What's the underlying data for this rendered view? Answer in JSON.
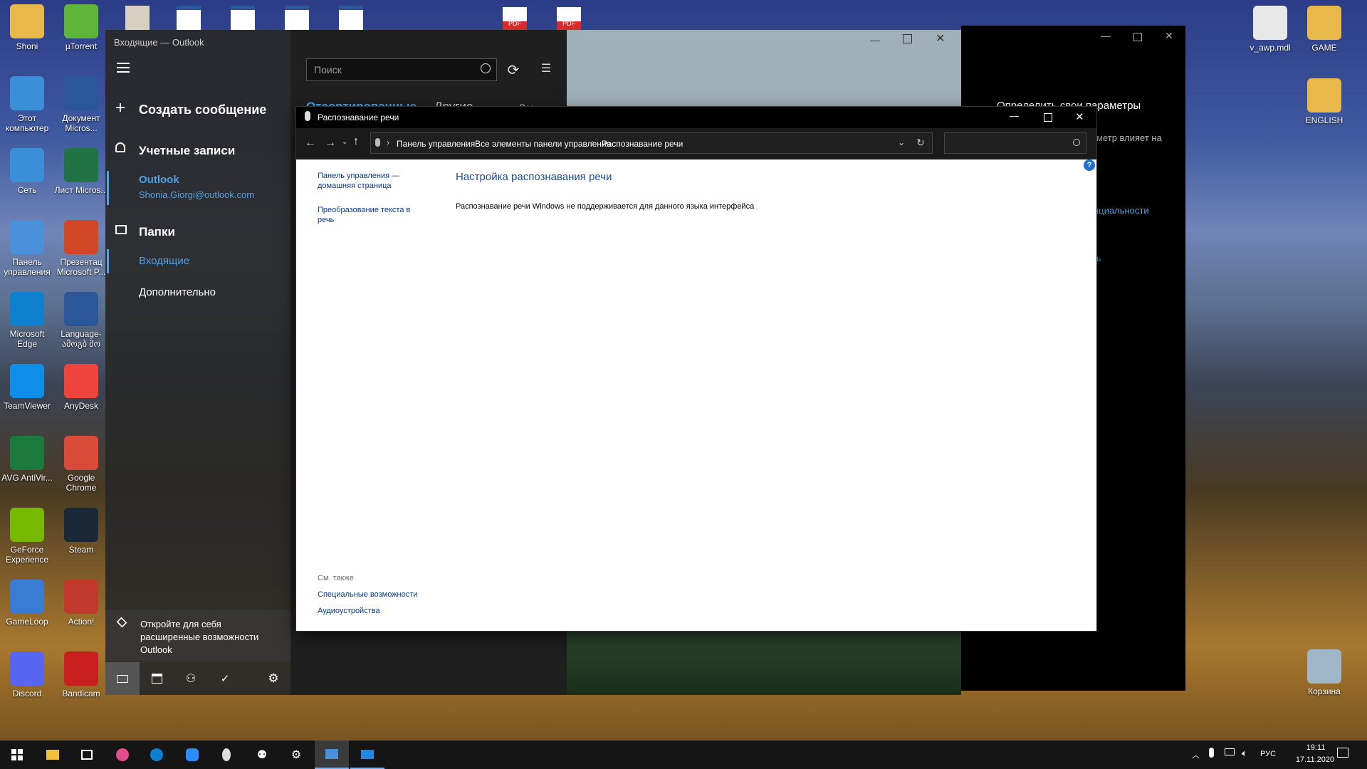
{
  "desktop": {
    "left_icons": [
      {
        "label": "Shoni",
        "icon": "user-folder-icon",
        "color": "#e8b84a"
      },
      {
        "label": "µTorrent",
        "icon": "utorrent-icon",
        "color": "#5fb53a"
      },
      {
        "label": "Этот компьютер",
        "icon": "computer-icon",
        "color": "#3a8fd8"
      },
      {
        "label": "Документ Micros...",
        "icon": "word-doc-icon",
        "color": "#2b579a"
      },
      {
        "label": "Сеть",
        "icon": "network-icon",
        "color": "#3a8fd8"
      },
      {
        "label": "Лист Micros...",
        "icon": "excel-sheet-icon",
        "color": "#217346"
      },
      {
        "label": "Панель управления",
        "icon": "control-panel-icon",
        "color": "#4a90d8"
      },
      {
        "label": "Презентац Microsoft P...",
        "icon": "powerpoint-icon",
        "color": "#d24726"
      },
      {
        "label": "Microsoft Edge",
        "icon": "edge-icon",
        "color": "#0f7fd0"
      },
      {
        "label": "Language- ამოგბ მო",
        "icon": "word-doc-icon",
        "color": "#2b579a"
      },
      {
        "label": "TeamViewer",
        "icon": "teamviewer-icon",
        "color": "#0e8ee9"
      },
      {
        "label": "AnyDesk",
        "icon": "anydesk-icon",
        "color": "#ef443b"
      },
      {
        "label": "AVG AntiVir...",
        "icon": "avg-icon",
        "color": "#1b7a3e"
      },
      {
        "label": "Google Chrome",
        "icon": "chrome-icon",
        "color": "#d94a38"
      },
      {
        "label": "GeForce Experience",
        "icon": "geforce-icon",
        "color": "#76b900"
      },
      {
        "label": "Steam",
        "icon": "steam-icon",
        "color": "#1b2838"
      },
      {
        "label": "GameLoop",
        "icon": "gameloop-icon",
        "color": "#3a7bd5"
      },
      {
        "label": "Action!",
        "icon": "action-icon",
        "color": "#c0392b"
      },
      {
        "label": "Discord",
        "icon": "discord-icon",
        "color": "#5865f2"
      },
      {
        "label": "Bandicam",
        "icon": "bandicam-icon",
        "color": "#c81e1e"
      }
    ],
    "right_icons": [
      {
        "label": "v_awp.mdl",
        "icon": "file-icon",
        "color": "#e8e8e8"
      },
      {
        "label": "GAME",
        "icon": "folder-icon",
        "color": "#e8b84a"
      },
      {
        "label": "ENGLISH",
        "icon": "folder-icon",
        "color": "#e8b84a"
      },
      {
        "label": "Корзина",
        "icon": "recycle-bin-icon",
        "color": "#9fb7c8"
      }
    ],
    "top_partial_icons": [
      {
        "label": "PDF",
        "icon": "pdf-icon"
      },
      {
        "label": "PDF",
        "icon": "pdf-icon"
      }
    ]
  },
  "outlook": {
    "window_title": "Входящие — Outlook",
    "new_message": "Создать сообщение",
    "accounts_label": "Учетные записи",
    "account_name": "Outlook",
    "account_email": "Shonia.Giorgi@outlook.com",
    "folders_label": "Папки",
    "folder_inbox": "Входящие",
    "folder_more": "Дополнительно",
    "promo_text": "Откройте для себя расширенные возможности Outlook",
    "search_placeholder": "Поиск",
    "tab_focused": "Отсортированные",
    "tab_other": "Другие",
    "filter_label": "Все"
  },
  "dark_window": {
    "heading": "Определить свои параметры",
    "text1": "метр влияет на",
    "link1": "нциальности",
    "link2": "ь"
  },
  "control_panel": {
    "title": "Распознавание речи",
    "breadcrumb": [
      "Панель управления",
      "Все элементы панели управления",
      "Распознавание речи"
    ],
    "sidebar_home": "Панель управления — домашняя страница",
    "sidebar_tts": "Преобразование текста в речь",
    "heading": "Настройка распознавания речи",
    "message": "Распознавание речи Windows не поддерживается для данного языка интерфейса",
    "see_also": "См. также",
    "see_also_links": [
      "Специальные возможности",
      "Аудиоустройства"
    ],
    "help": "?"
  },
  "taskbar": {
    "lang": "РУС",
    "time": "19:11",
    "date": "17.11.2020"
  },
  "colors": {
    "outlook_accent": "#4fa3e6",
    "cp_link": "#0a3a8c",
    "cp_heading": "#1e4e9a"
  }
}
